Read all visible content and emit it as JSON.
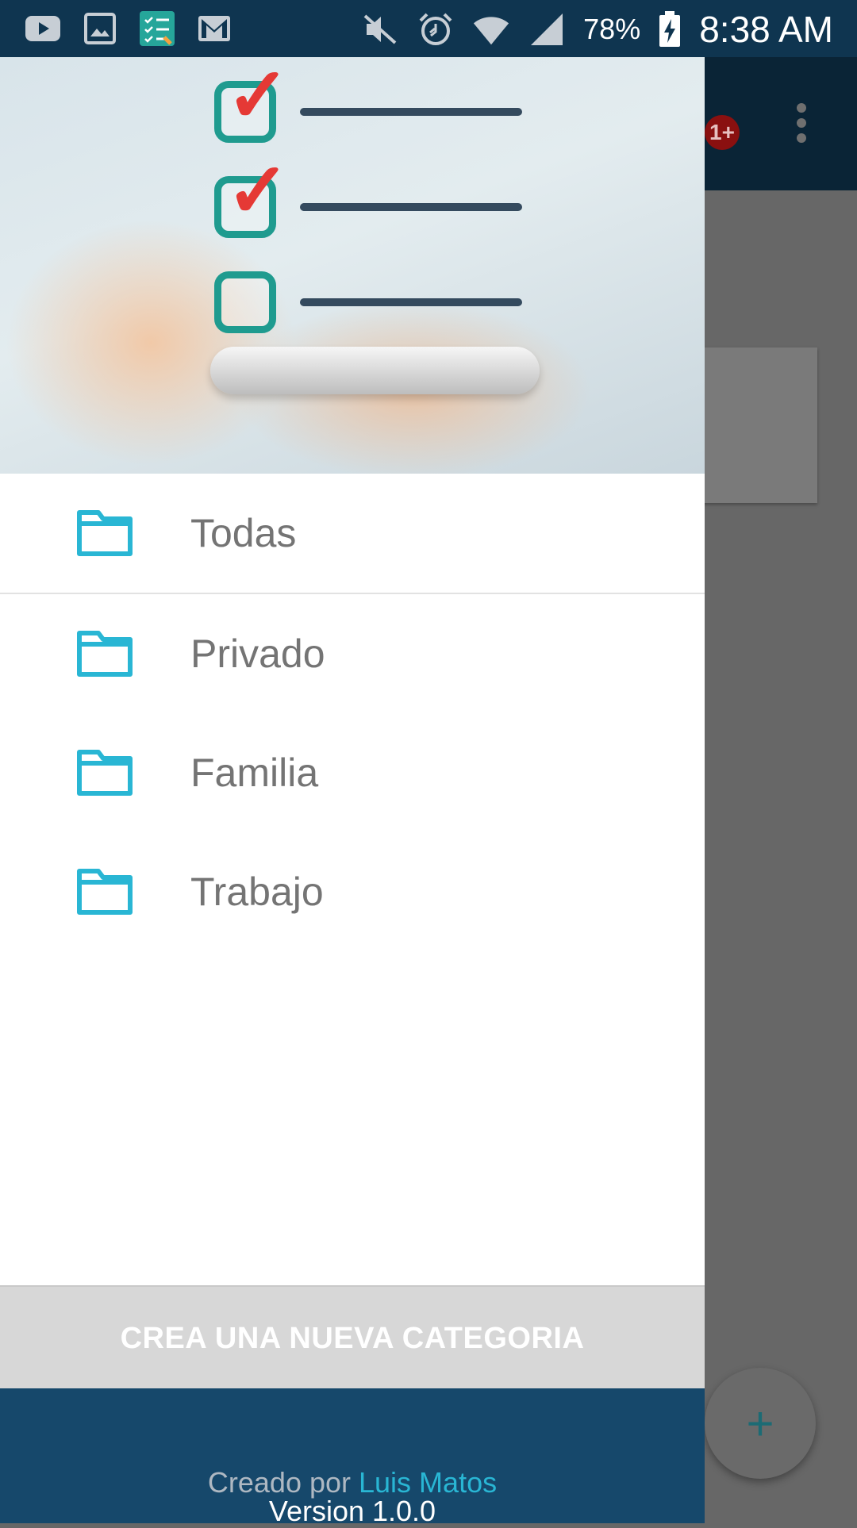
{
  "status_bar": {
    "battery_percent": "78%",
    "time": "8:38 AM"
  },
  "background_app": {
    "notification_badge": "1+",
    "fab_label": "+"
  },
  "drawer": {
    "menu_items": [
      {
        "label": "Todas",
        "icon": "folder-icon"
      },
      {
        "label": "Privado",
        "icon": "folder-icon"
      },
      {
        "label": "Familia",
        "icon": "folder-icon"
      },
      {
        "label": "Trabajo",
        "icon": "folder-icon"
      }
    ],
    "create_button_label": "CREA UNA NUEVA CATEGORIA",
    "footer": {
      "created_by_prefix": "Creado por ",
      "author": "Luis Matos",
      "version": "Version 1.0.0"
    }
  },
  "colors": {
    "accent": "#29b6d4",
    "footer_bg": "#16486b",
    "status_bar_bg": "#0f3550",
    "check_red": "#e53935",
    "check_teal": "#1f9b8f"
  }
}
